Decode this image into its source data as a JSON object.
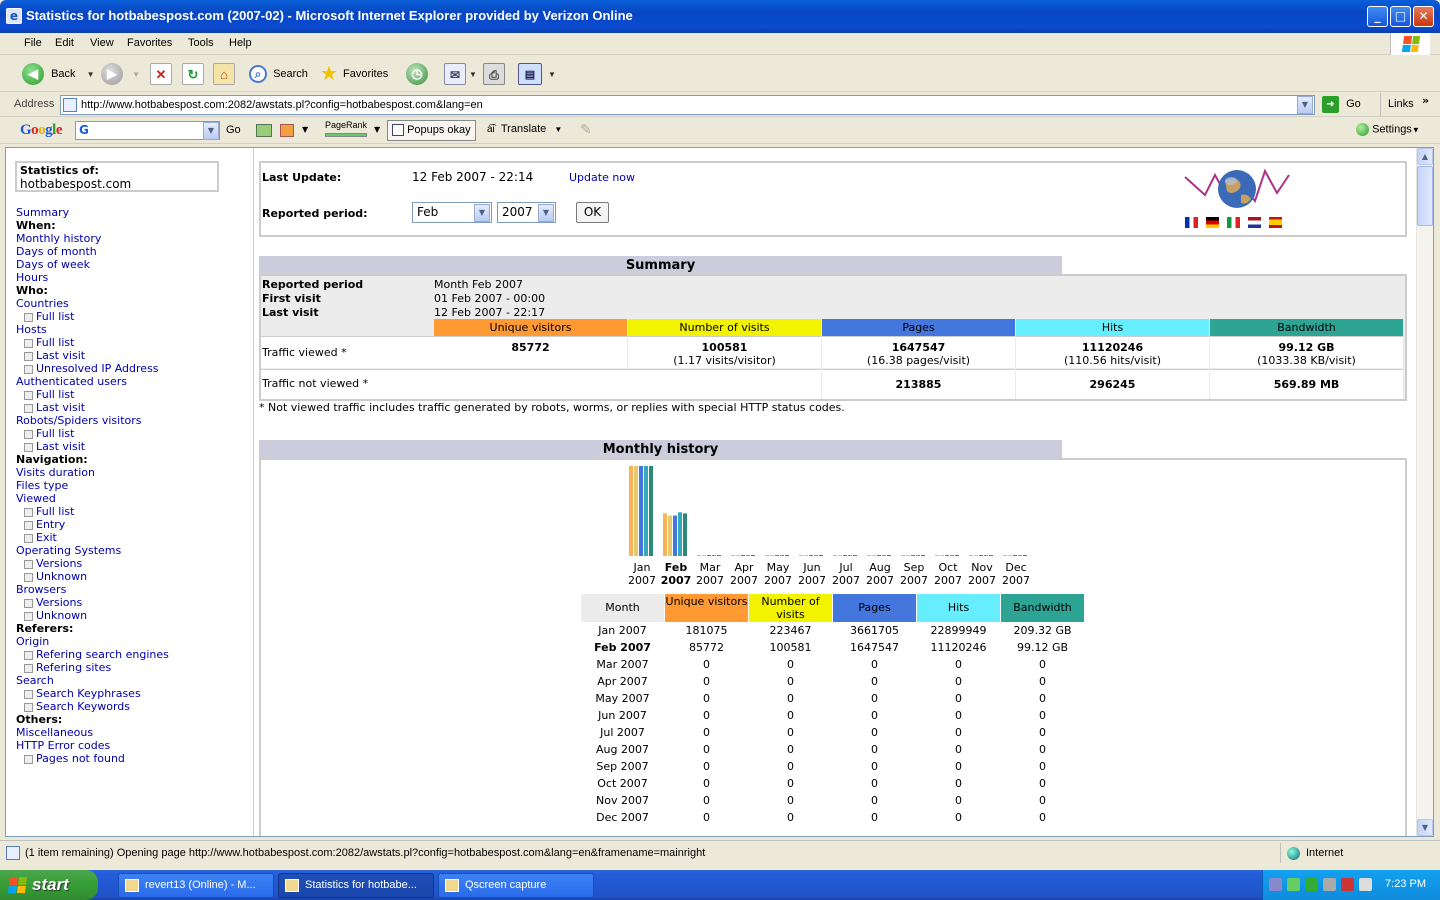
{
  "window": {
    "title": "Statistics for hotbabespost.com (2007-02) - Microsoft Internet Explorer provided by Verizon Online",
    "controls": {
      "minimize": "_",
      "maximize": "□",
      "close": "✕"
    }
  },
  "menu": [
    "File",
    "Edit",
    "View",
    "Favorites",
    "Tools",
    "Help"
  ],
  "toolbar": {
    "back": "Back",
    "search": "Search",
    "favorites": "Favorites"
  },
  "address": {
    "label": "Address",
    "url": "http://www.hotbabespost.com:2082/awstats.pl?config=hotbabespost.com&lang=en",
    "go": "Go",
    "links": "Links"
  },
  "googlebar": {
    "logo": "Google",
    "go": "Go",
    "pagerank": "PageRank",
    "popups": "Popups okay",
    "translate": "Translate",
    "settings": "Settings"
  },
  "sidebar": {
    "stat_label": "Statistics of:",
    "site": "hotbabespost.com",
    "items": [
      {
        "t": "Summary",
        "k": "link"
      },
      {
        "t": "When:",
        "k": "hdr"
      },
      {
        "t": "Monthly history",
        "k": "link"
      },
      {
        "t": "Days of month",
        "k": "link"
      },
      {
        "t": "Days of week",
        "k": "link"
      },
      {
        "t": "Hours",
        "k": "link"
      },
      {
        "t": "Who:",
        "k": "hdr"
      },
      {
        "t": "Countries",
        "k": "link"
      },
      {
        "t": "Full list",
        "k": "sub"
      },
      {
        "t": "Hosts",
        "k": "link"
      },
      {
        "t": "Full list",
        "k": "sub"
      },
      {
        "t": "Last visit",
        "k": "sub"
      },
      {
        "t": "Unresolved IP Address",
        "k": "sub"
      },
      {
        "t": "Authenticated users",
        "k": "link"
      },
      {
        "t": "Full list",
        "k": "sub"
      },
      {
        "t": "Last visit",
        "k": "sub"
      },
      {
        "t": "Robots/Spiders visitors",
        "k": "link"
      },
      {
        "t": "Full list",
        "k": "sub"
      },
      {
        "t": "Last visit",
        "k": "sub"
      },
      {
        "t": "Navigation:",
        "k": "hdr"
      },
      {
        "t": "Visits duration",
        "k": "link"
      },
      {
        "t": "Files type",
        "k": "link"
      },
      {
        "t": "Viewed",
        "k": "link"
      },
      {
        "t": "Full list",
        "k": "sub"
      },
      {
        "t": "Entry",
        "k": "sub"
      },
      {
        "t": "Exit",
        "k": "sub"
      },
      {
        "t": "Operating Systems",
        "k": "link"
      },
      {
        "t": "Versions",
        "k": "sub"
      },
      {
        "t": "Unknown",
        "k": "sub"
      },
      {
        "t": "Browsers",
        "k": "link"
      },
      {
        "t": "Versions",
        "k": "sub"
      },
      {
        "t": "Unknown",
        "k": "sub"
      },
      {
        "t": "Referers:",
        "k": "hdr"
      },
      {
        "t": "Origin",
        "k": "link"
      },
      {
        "t": "Refering search engines",
        "k": "sub"
      },
      {
        "t": "Refering sites",
        "k": "sub"
      },
      {
        "t": "Search",
        "k": "link"
      },
      {
        "t": "Search Keyphrases",
        "k": "sub"
      },
      {
        "t": "Search Keywords",
        "k": "sub"
      },
      {
        "t": "Others:",
        "k": "hdr"
      },
      {
        "t": "Miscellaneous",
        "k": "link"
      },
      {
        "t": "HTTP Error codes",
        "k": "link"
      },
      {
        "t": "Pages not found",
        "k": "sub"
      }
    ]
  },
  "update": {
    "last_update_label": "Last Update:",
    "last_update_value": "12 Feb 2007 - 22:14",
    "update_now": "Update now",
    "period_label": "Reported period:",
    "month": "Feb",
    "year": "2007",
    "ok": "OK"
  },
  "summary": {
    "title": "Summary",
    "reported_period_label": "Reported period",
    "reported_period_value": "Month Feb 2007",
    "first_visit_label": "First visit",
    "first_visit_value": "01 Feb 2007 - 00:00",
    "last_visit_label": "Last visit",
    "last_visit_value": "12 Feb 2007 - 22:17",
    "headers": [
      "Unique visitors",
      "Number of visits",
      "Pages",
      "Hits",
      "Bandwidth"
    ],
    "header_colors": [
      "#ff9933",
      "#f3f300",
      "#4477dd",
      "#66eeff",
      "#2ea495"
    ],
    "viewed_label": "Traffic viewed *",
    "viewed": [
      [
        "85772",
        ""
      ],
      [
        "100581",
        "(1.17 visits/visitor)"
      ],
      [
        "1647547",
        "(16.38 pages/visit)"
      ],
      [
        "11120246",
        "(110.56 hits/visit)"
      ],
      [
        "99.12 GB",
        "(1033.38 KB/visit)"
      ]
    ],
    "notviewed_label": "Traffic not viewed *",
    "notviewed": [
      "",
      "",
      "213885",
      "296245",
      "569.89 MB"
    ],
    "footnote": "* Not viewed traffic includes traffic generated by robots, worms, or replies with special HTTP status codes."
  },
  "monthly": {
    "title": "Monthly history",
    "headers": [
      "Month",
      "Unique visitors",
      "Number of visits",
      "Pages",
      "Hits",
      "Bandwidth"
    ],
    "rows": [
      [
        "Jan 2007",
        "181075",
        "223467",
        "3661705",
        "22899949",
        "209.32 GB"
      ],
      [
        "Feb 2007",
        "85772",
        "100581",
        "1647547",
        "11120246",
        "99.12 GB"
      ],
      [
        "Mar 2007",
        "0",
        "0",
        "0",
        "0",
        "0"
      ],
      [
        "Apr 2007",
        "0",
        "0",
        "0",
        "0",
        "0"
      ],
      [
        "May 2007",
        "0",
        "0",
        "0",
        "0",
        "0"
      ],
      [
        "Jun 2007",
        "0",
        "0",
        "0",
        "0",
        "0"
      ],
      [
        "Jul 2007",
        "0",
        "0",
        "0",
        "0",
        "0"
      ],
      [
        "Aug 2007",
        "0",
        "0",
        "0",
        "0",
        "0"
      ],
      [
        "Sep 2007",
        "0",
        "0",
        "0",
        "0",
        "0"
      ],
      [
        "Oct 2007",
        "0",
        "0",
        "0",
        "0",
        "0"
      ],
      [
        "Nov 2007",
        "0",
        "0",
        "0",
        "0",
        "0"
      ],
      [
        "Dec 2007",
        "0",
        "0",
        "0",
        "0",
        "0"
      ]
    ],
    "current_row": 1
  },
  "chart_data": {
    "type": "bar",
    "title": "",
    "categories": [
      "Jan",
      "Feb",
      "Mar",
      "Apr",
      "May",
      "Jun",
      "Jul",
      "Aug",
      "Sep",
      "Oct",
      "Nov",
      "Dec"
    ],
    "years": [
      "2007",
      "2007",
      "2007",
      "2007",
      "2007",
      "2007",
      "2007",
      "2007",
      "2007",
      "2007",
      "2007",
      "2007"
    ],
    "current_index": 1,
    "series": [
      {
        "name": "Unique visitors",
        "color": "#ffb055",
        "values": [
          181075,
          85772,
          0,
          0,
          0,
          0,
          0,
          0,
          0,
          0,
          0,
          0
        ]
      },
      {
        "name": "Number of visits",
        "color": "#e6c870",
        "values": [
          223467,
          100581,
          0,
          0,
          0,
          0,
          0,
          0,
          0,
          0,
          0,
          0
        ]
      },
      {
        "name": "Pages",
        "color": "#4477dd",
        "values": [
          3661705,
          1647547,
          0,
          0,
          0,
          0,
          0,
          0,
          0,
          0,
          0,
          0
        ]
      },
      {
        "name": "Hits",
        "color": "#33aabb",
        "values": [
          22899949,
          11120246,
          0,
          0,
          0,
          0,
          0,
          0,
          0,
          0,
          0,
          0
        ]
      },
      {
        "name": "Bandwidth",
        "color": "#2e8877",
        "values": [
          209.32,
          99.12,
          0,
          0,
          0,
          0,
          0,
          0,
          0,
          0,
          0,
          0
        ]
      }
    ]
  },
  "status": {
    "text": "(1 item remaining) Opening page http://www.hotbabespost.com:2082/awstats.pl?config=hotbabespost.com&lang=en&framename=mainright",
    "zone": "Internet"
  },
  "taskbar": {
    "start": "start",
    "tasks": [
      "revert13 (Online) - M...",
      "Statistics for hotbabe...",
      "Qscreen capture"
    ],
    "active_task": 1,
    "clock": "7:23 PM"
  }
}
